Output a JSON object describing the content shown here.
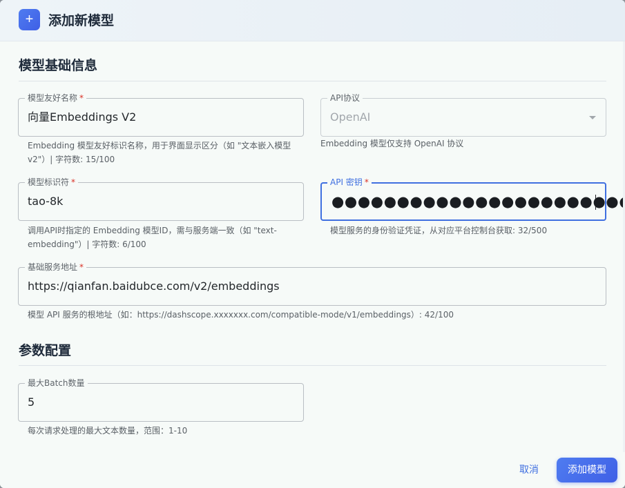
{
  "dialog": {
    "title": "添加新模型",
    "header_icon": "+"
  },
  "sections": {
    "basic_title": "模型基础信息",
    "params_title": "参数配置"
  },
  "fields": {
    "friendly_name": {
      "label": "模型友好名称",
      "required": "*",
      "value": "向量Embeddings V2",
      "helper_line1": "Embedding 模型友好标识名称，用于界面显示区分（如 \"文本嵌入模型",
      "helper_line2": "v2\"）| 字符数: 15/100"
    },
    "api_protocol": {
      "label": "API协议",
      "value": "OpenAI",
      "helper": "Embedding 模型仅支持 OpenAI 协议"
    },
    "model_id": {
      "label": "模型标识符",
      "required": "*",
      "value": "tao-8k",
      "helper_line1": "调用API时指定的 Embedding 模型ID，需与服务端一致（如 \"text-",
      "helper_line2": "embedding\"）| 字符数: 6/100"
    },
    "api_key": {
      "label": "API 密钥",
      "required": "*",
      "masked_value": "●●●●●●●●●●●●●●●●●●●●●●●●●●",
      "helper": "模型服务的身份验证凭证，从对应平台控制台获取: 32/500"
    },
    "base_url": {
      "label": "基础服务地址",
      "required": "*",
      "value": "https://qianfan.baidubce.com/v2/embeddings",
      "helper": "模型 API 服务的根地址（如：https://dashscope.xxxxxxx.com/compatible-mode/v1/embeddings）: 42/100"
    },
    "max_batch": {
      "label": "最大Batch数量",
      "value": "5",
      "helper": "每次请求处理的最大文本数量，范围：1-10"
    }
  },
  "footer": {
    "cancel_label": "取消",
    "submit_label": "添加模型"
  },
  "colors": {
    "accent": "#3f6fe0",
    "required": "#d93025",
    "background": "#f6faf8"
  }
}
